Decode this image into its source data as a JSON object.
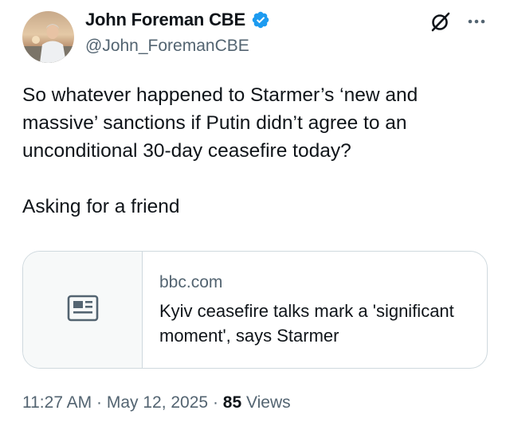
{
  "author": {
    "name": "John Foreman CBE",
    "handle": "@John_ForemanCBE",
    "verified_color": "#1d9bf0"
  },
  "tweet": {
    "text": "So whatever happened to Starmer’s ‘new and massive’ sanctions if Putin didn’t agree to an unconditional 30-day ceasefire today?\n\nAsking for a friend"
  },
  "link_card": {
    "domain": "bbc.com",
    "title": "Kyiv ceasefire talks mark a 'significant moment', says Starmer",
    "thumbnail_icon": "article-icon"
  },
  "meta": {
    "time": "11:27 AM",
    "separator": " · ",
    "date": "May 12, 2025",
    "views_count": "85",
    "views_label": " Views"
  },
  "icons": {
    "grok": "grok-icon",
    "more": "more-icon"
  }
}
